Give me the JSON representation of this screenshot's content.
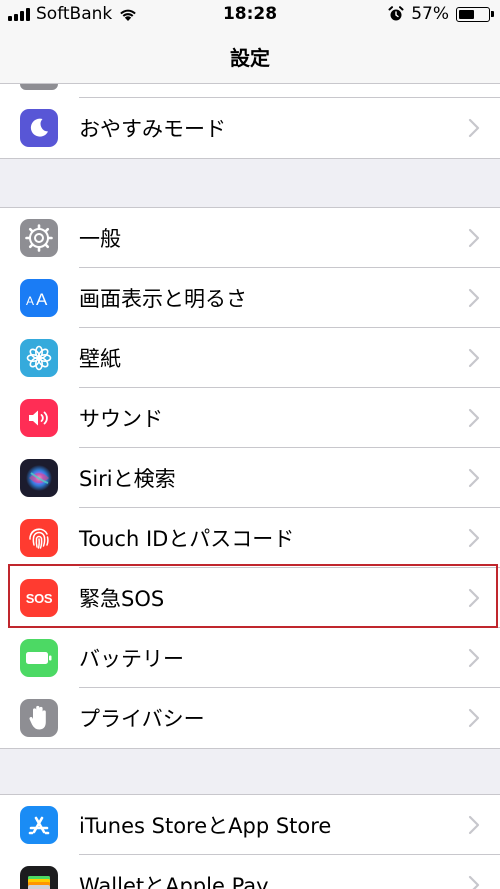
{
  "status_bar": {
    "carrier": "SoftBank",
    "time": "18:28",
    "battery_percent": "57%",
    "battery_level": 0.57,
    "icons": [
      "signal-bars-icon",
      "wifi-icon",
      "alarm-clock-icon",
      "battery-icon"
    ]
  },
  "nav": {
    "title": "設定"
  },
  "groups": [
    {
      "items": [
        {
          "label": "おやすみモード",
          "icon": "moon-icon",
          "icon_color": "#5856d6"
        }
      ]
    },
    {
      "items": [
        {
          "label": "一般",
          "icon": "gear-icon",
          "icon_color": "#8e8e93"
        },
        {
          "label": "画面表示と明るさ",
          "icon": "text-size-icon",
          "icon_color": "#1a7cf5"
        },
        {
          "label": "壁紙",
          "icon": "flower-icon",
          "icon_color": "#35aadc"
        },
        {
          "label": "サウンド",
          "icon": "speaker-icon",
          "icon_color": "#ff2d55"
        },
        {
          "label": "Siriと検索",
          "icon": "siri-icon",
          "icon_color": "#1c1c2e"
        },
        {
          "label": "Touch IDとパスコード",
          "icon": "fingerprint-icon",
          "icon_color": "#ff3b30"
        },
        {
          "label": "緊急SOS",
          "icon": "sos-icon",
          "icon_color": "#ff3b30",
          "icon_text": "SOS",
          "highlighted": true
        },
        {
          "label": "バッテリー",
          "icon": "battery-icon",
          "icon_color": "#4cd964"
        },
        {
          "label": "プライバシー",
          "icon": "hand-icon",
          "icon_color": "#8e8e93"
        }
      ]
    },
    {
      "items": [
        {
          "label": "iTunes StoreとApp Store",
          "icon": "app-store-icon",
          "icon_color": "#1a8cf5"
        },
        {
          "label": "WalletとApple Pay",
          "icon": "wallet-icon",
          "icon_color": "#1c1c1e"
        }
      ]
    }
  ]
}
